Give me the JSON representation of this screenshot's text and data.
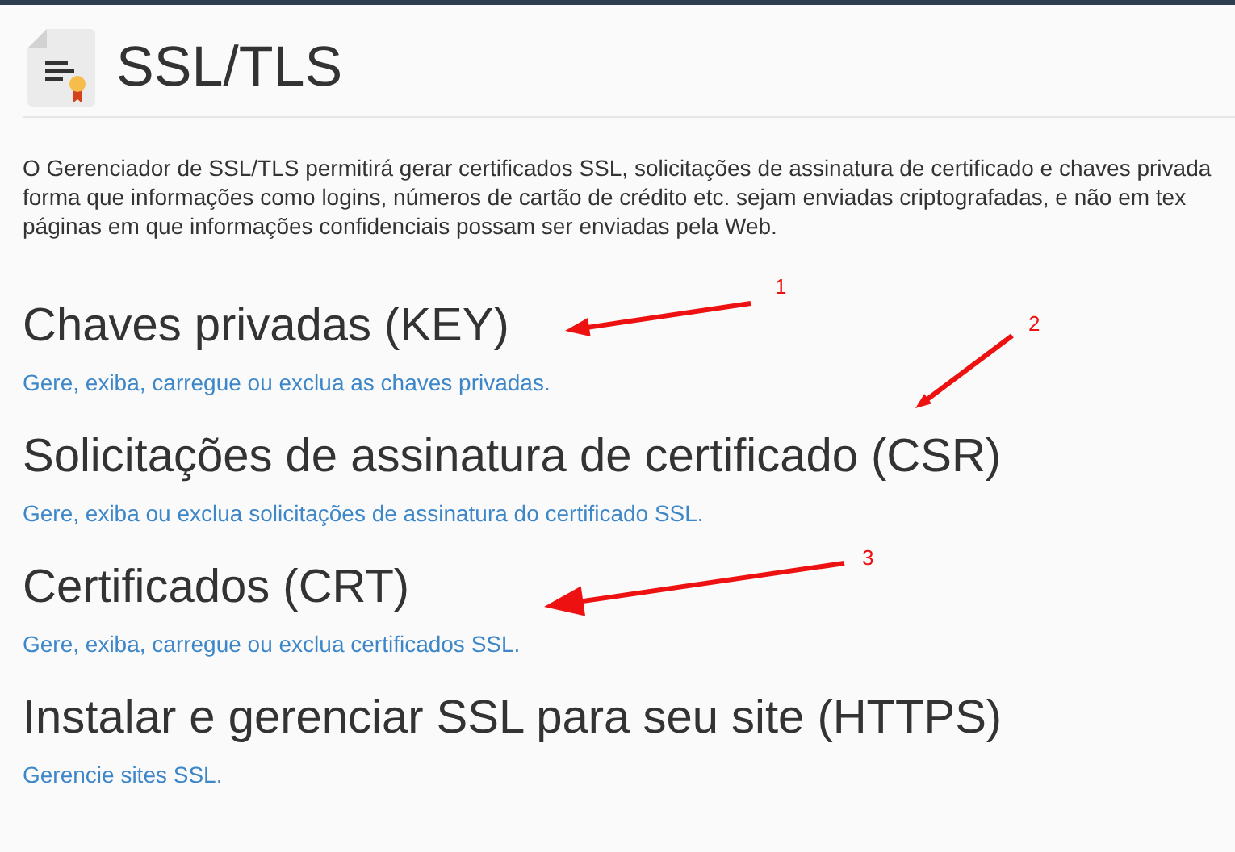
{
  "page": {
    "title": "SSL/TLS"
  },
  "intro": {
    "lines": [
      "O Gerenciador de SSL/TLS permitirá gerar certificados SSL, solicitações de assinatura de certificado e chaves privada",
      "forma que informações como logins, números de cartão de crédito etc. sejam enviadas criptografadas, e não em tex",
      "páginas em que informações confidenciais possam ser enviadas pela Web."
    ]
  },
  "sections": [
    {
      "heading": "Chaves privadas (KEY)",
      "link": "Gere, exiba, carregue ou exclua as chaves privadas."
    },
    {
      "heading": "Solicitações de assinatura de certificado (CSR)",
      "link": "Gere, exiba ou exclua solicitações de assinatura do certificado SSL."
    },
    {
      "heading": "Certificados (CRT)",
      "link": "Gere, exiba, carregue ou exclua certificados SSL."
    },
    {
      "heading": "Instalar e gerenciar SSL para seu site (HTTPS)",
      "link": "Gerencie sites SSL."
    }
  ],
  "annotations": [
    {
      "label": "1"
    },
    {
      "label": "2"
    },
    {
      "label": "3"
    }
  ]
}
